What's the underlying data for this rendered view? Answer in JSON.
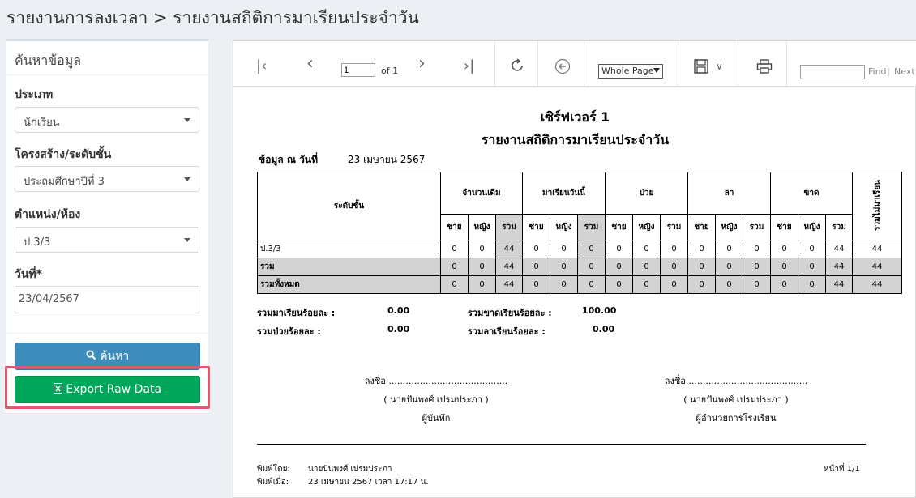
{
  "header": {
    "breadcrumb": "รายงานการลงเวลา > รายงานสถิติการมาเรียนประจำวัน"
  },
  "search_panel": {
    "title": "ค้นหาข้อมูล",
    "type_label": "ประเภท",
    "type_value": "นักเรียน",
    "structure_label": "โครงสร้าง/ระดับชั้น",
    "structure_value": "ประถมศึกษาปีที่ 3",
    "position_label": "ตำแหน่ง/ห้อง",
    "position_value": "ป.3/3",
    "date_label": "วันที่*",
    "date_value": "23/04/2567",
    "search_button": "ค้นหา",
    "export_button": "Export Raw Data"
  },
  "toolbar": {
    "page_value": "1",
    "of_text": "of 1",
    "zoom_value": "Whole Page",
    "find_label": "Find",
    "separator": "|",
    "next_label": "Next"
  },
  "report": {
    "server_title": "เซิร์ฟเวอร์ 1",
    "report_title": "รายงานสถิติการมาเรียนประจำวัน",
    "asof_label": "ข้อมูล ณ วันที่",
    "asof_value": "23 เมษายน 2567",
    "table": {
      "level_header": "ระดับชั้น",
      "groups": [
        "จำนวนเดิม",
        "มาเรียนวันนี้",
        "ป่วย",
        "ลา",
        "ขาด"
      ],
      "absent_total_header": "รวมไม่มาเรียน",
      "sub": [
        "ชาย",
        "หญิง",
        "รวม"
      ],
      "rows": [
        {
          "label": "ป.3/3",
          "values": [
            "0",
            "0",
            "44",
            "0",
            "0",
            "0",
            "0",
            "0",
            "0",
            "0",
            "0",
            "0",
            "0",
            "0",
            "44",
            "44"
          ]
        },
        {
          "label": "รวม",
          "values": [
            "0",
            "0",
            "44",
            "0",
            "0",
            "0",
            "0",
            "0",
            "0",
            "0",
            "0",
            "0",
            "0",
            "0",
            "44",
            "44"
          ]
        },
        {
          "label": "รวมทั้งหมด",
          "values": [
            "0",
            "0",
            "44",
            "0",
            "0",
            "0",
            "0",
            "0",
            "0",
            "0",
            "0",
            "0",
            "0",
            "0",
            "44",
            "44"
          ]
        }
      ]
    },
    "summary": {
      "present_label": "รวมมาเรียนร้อยละ :",
      "present_value": "0.00",
      "absent_label": "รวมขาดเรียนร้อยละ :",
      "absent_value": "100.00",
      "sick_label": "รวมป่วยร้อยละ :",
      "sick_value": "0.00",
      "leave_label": "รวมลาเรียนร้อยละ :",
      "leave_value": "0.00"
    },
    "signatures": {
      "left_sign": "ลงชื่อ ..........................................",
      "left_name": "( นายปันพงศ์ เปรมประภา )",
      "left_role": "ผู้บันทึก",
      "right_sign": "ลงชื่อ ..........................................",
      "right_name": "( นายปันพงศ์ เปรมประภา )",
      "right_role": "ผู้อำนวยการโรงเรียน"
    },
    "footer": {
      "printed_by_label": "พิมพ์โดย:",
      "printed_by_value": "นายปันพงศ์ เปรมประภา",
      "printed_at_label": "พิมพ์เมื่อ:",
      "printed_at_value": "23 เมษายน 2567 เวลา 17:17 น.",
      "page_label": "หน้าที่ 1/1"
    }
  }
}
